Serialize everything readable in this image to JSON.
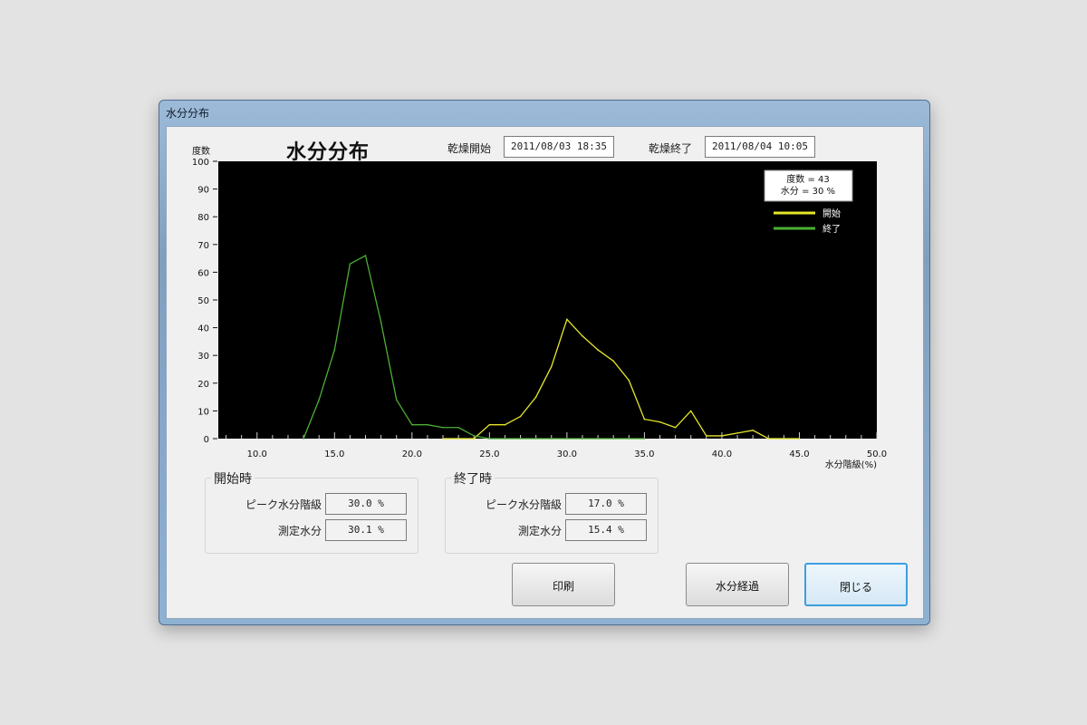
{
  "window": {
    "title": "水分分布"
  },
  "header": {
    "title": "水分分布",
    "start_label": "乾燥開始",
    "start_value": "2011/08/03 18:35",
    "end_label": "乾燥終了",
    "end_value": "2011/08/04 10:05"
  },
  "chart_data": {
    "type": "line",
    "ylabel": "度数",
    "xlabel": "水分階級(%)",
    "xlim": [
      7.5,
      50.0
    ],
    "ylim": [
      0,
      100
    ],
    "x_ticks": [
      "10.0",
      "15.0",
      "20.0",
      "25.0",
      "30.0",
      "35.0",
      "40.0",
      "45.0",
      "50.0"
    ],
    "y_ticks": [
      "100",
      "90",
      "80",
      "70",
      "60",
      "50",
      "40",
      "30",
      "20",
      "10",
      "0"
    ],
    "tooltip": [
      "度数 = 43",
      "水分 = 30 %"
    ],
    "legend_position": "top-right",
    "series": [
      {
        "name": "開始",
        "color": "#e6e62a",
        "x": [
          22,
          23,
          24,
          25,
          26,
          27,
          28,
          29,
          30,
          31,
          32,
          33,
          34,
          35,
          36,
          37,
          38,
          39,
          40,
          41,
          42,
          43,
          44,
          45
        ],
        "y": [
          0,
          0,
          0,
          5,
          5,
          8,
          15,
          26,
          43,
          37,
          32,
          28,
          21,
          7,
          6,
          4,
          10,
          1,
          1,
          2,
          3,
          0,
          0,
          0
        ]
      },
      {
        "name": "終了",
        "color": "#4caf35",
        "x": [
          13,
          14,
          15,
          16,
          17,
          18,
          19,
          20,
          21,
          22,
          23,
          24,
          25,
          26,
          27,
          28,
          29,
          30,
          31,
          32,
          33,
          34,
          35
        ],
        "y": [
          0,
          14,
          32,
          63,
          66,
          42,
          14,
          5,
          5,
          4,
          4,
          1,
          0,
          0,
          0,
          0,
          0,
          0,
          0,
          0,
          0,
          0,
          0
        ]
      }
    ]
  },
  "start_group": {
    "title": "開始時",
    "peak_label": "ピーク水分階級",
    "peak_value": "30.0 %",
    "measured_label": "測定水分",
    "measured_value": "30.1 %"
  },
  "end_group": {
    "title": "終了時",
    "peak_label": "ピーク水分階級",
    "peak_value": "17.0 %",
    "measured_label": "測定水分",
    "measured_value": "15.4 %"
  },
  "buttons": {
    "print": "印刷",
    "history": "水分経過",
    "close": "閉じる"
  },
  "colors": {
    "plot_bg": "#000000",
    "start_series": "#e6e62a",
    "end_series": "#4caf35"
  }
}
